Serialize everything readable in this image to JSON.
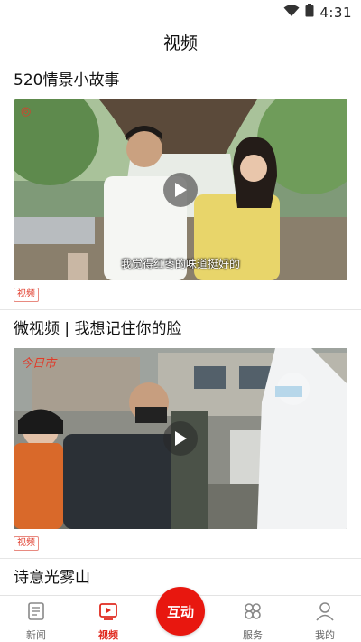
{
  "status_bar": {
    "time": "4:31",
    "wifi_icon": "wifi-icon",
    "battery_icon": "battery-icon"
  },
  "header": {
    "title": "视频"
  },
  "feed": [
    {
      "title": "520情景小故事",
      "subtitle": "我觉得红枣的味道挺好的",
      "tag": "视频",
      "play_icon": "play-icon"
    },
    {
      "title": "微视频 | 我想记住你的脸",
      "watermark": "今日市",
      "tag": "视频",
      "play_icon": "play-icon"
    },
    {
      "title": "诗意光雾山"
    }
  ],
  "tab_bar": {
    "tabs": [
      {
        "label": "新闻",
        "icon": "news-icon",
        "active": false
      },
      {
        "label": "视频",
        "icon": "video-icon",
        "active": true
      },
      {
        "label": "服务",
        "icon": "services-icon",
        "active": false
      },
      {
        "label": "我的",
        "icon": "profile-icon",
        "active": false
      }
    ],
    "center_label": "互动",
    "accent": "#e8170f"
  }
}
